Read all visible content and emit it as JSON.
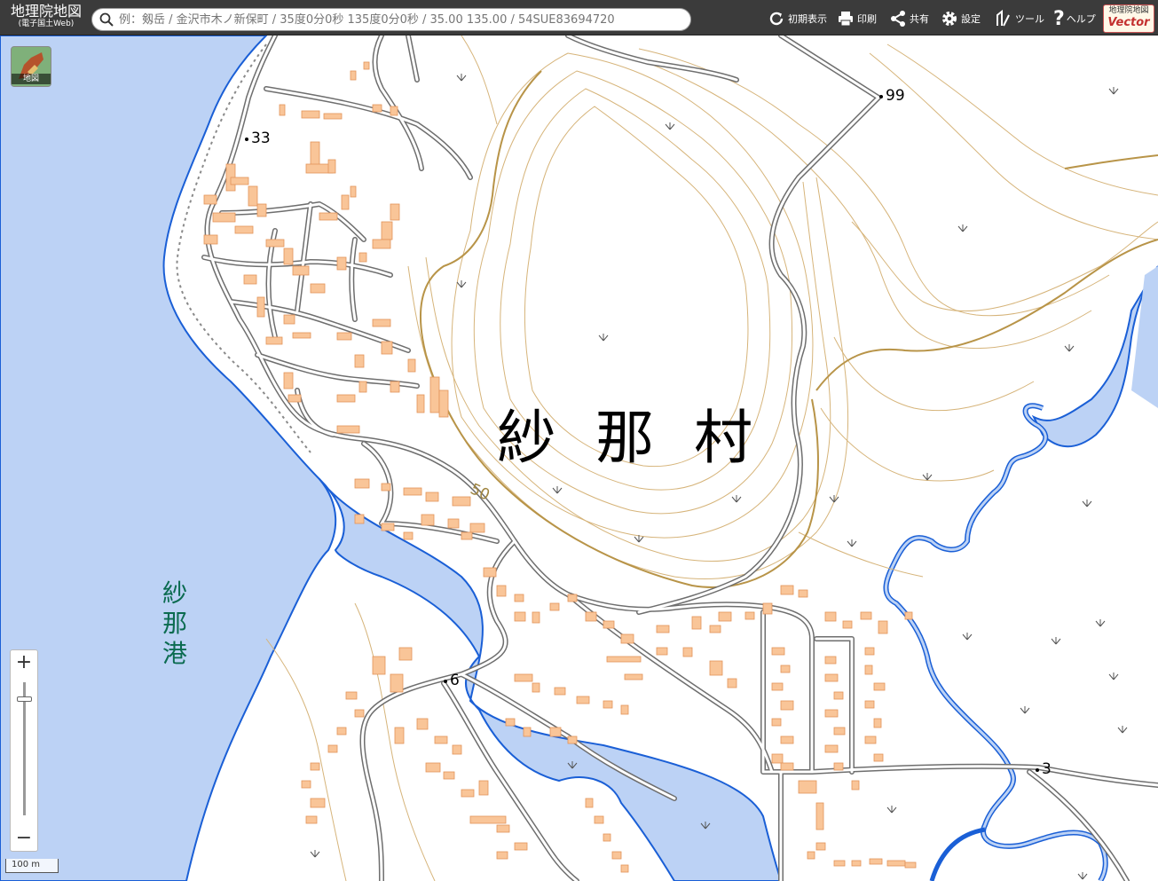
{
  "header": {
    "logo_line1": "地理院地図",
    "logo_line2": "(電子国土Web)",
    "search_placeholder": "例：剱岳 / 金沢市木ノ新保町 / 35度0分0秒 135度0分0秒 / 35.00 135.00 / 54SUE83694720",
    "buttons": [
      {
        "label": "初期表示",
        "icon": "refresh-icon"
      },
      {
        "label": "印刷",
        "icon": "printer-icon"
      },
      {
        "label": "共有",
        "icon": "share-icon"
      },
      {
        "label": "設定",
        "icon": "gear-icon"
      },
      {
        "label": "ツール",
        "icon": "tool-icon"
      },
      {
        "label": "ヘルプ",
        "icon": "help-icon"
      }
    ],
    "vector_logo_top": "地理院地図",
    "vector_logo_bottom": "Vector"
  },
  "map": {
    "layer_button_label": "地図",
    "village_label": "紗 那 村",
    "port_label": "紗那港",
    "elevation_points": [
      "99",
      "33",
      "6",
      "3"
    ],
    "contour_label": "50",
    "zoom_in": "+",
    "zoom_out": "−",
    "scale_label": "100 m",
    "colors": {
      "water": "#bcd2f5",
      "shore": "#1a5fd6",
      "building": "#f9c598",
      "road": "#6e6e6e",
      "contour": "#d6b47a",
      "header": "#3b3b3b"
    }
  }
}
